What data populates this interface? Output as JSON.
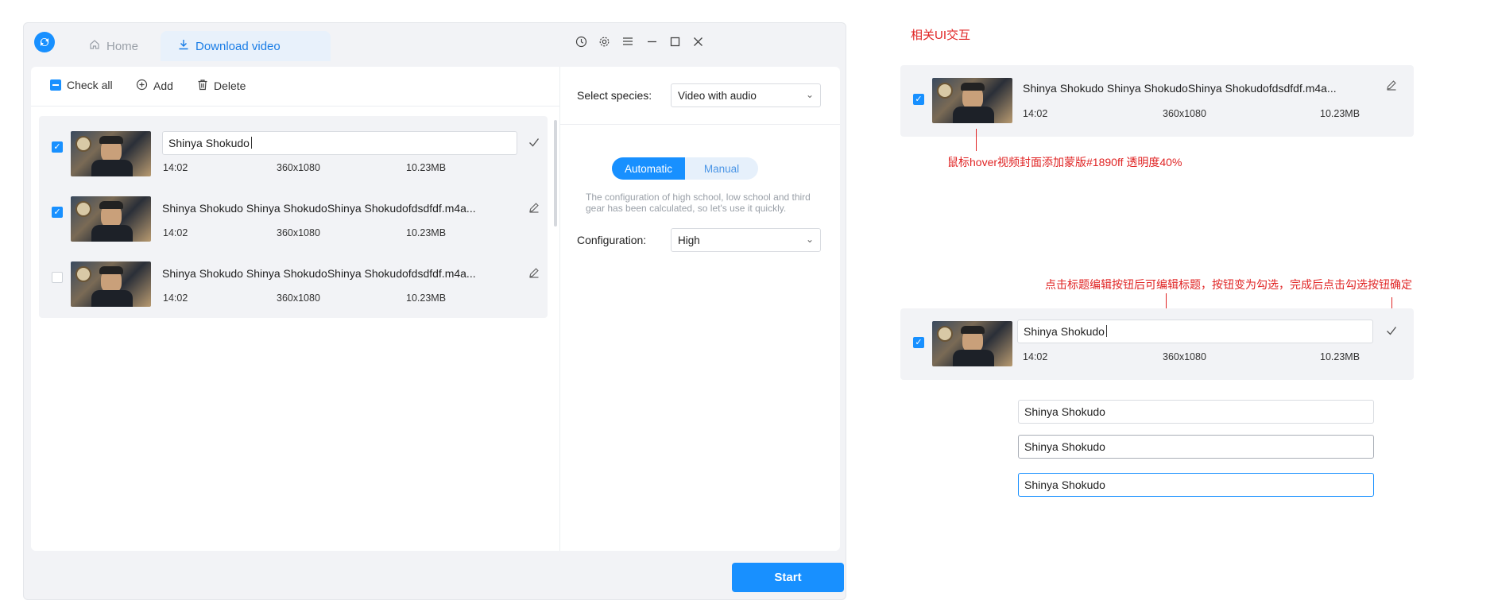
{
  "tabs": {
    "home": "Home",
    "download": "Download video"
  },
  "toolbar": {
    "check_all": "Check all",
    "add": "Add",
    "delete": "Delete"
  },
  "items": [
    {
      "edit_value": "Shinya Shokudo",
      "duration": "14:02",
      "resolution": "360x1080",
      "size": "10.23MB",
      "checked": true,
      "editing": true
    },
    {
      "title": "Shinya Shokudo Shinya ShokudoShinya Shokudofdsdfdf.m4a...",
      "duration": "14:02",
      "resolution": "360x1080",
      "size": "10.23MB",
      "checked": true,
      "editing": false
    },
    {
      "title": "Shinya Shokudo Shinya ShokudoShinya Shokudofdsdfdf.m4a...",
      "duration": "14:02",
      "resolution": "360x1080",
      "size": "10.23MB",
      "checked": false,
      "editing": false
    }
  ],
  "settings": {
    "species_label": "Select species:",
    "species_value": "Video with audio",
    "mode_automatic": "Automatic",
    "mode_manual": "Manual",
    "description": "The configuration of high school, low school and third gear has been calculated, so let's use it quickly.",
    "config_label": "Configuration:",
    "config_value": "High"
  },
  "start_label": "Start",
  "annotations": {
    "title": "相关UI交互",
    "hover_note": "鼠标hover视频封面添加蒙版#1890ff  透明度40%",
    "edit_note": "点击标题编辑按钮后可编辑标题，按钮变为勾选，完成后点击勾选按钮确定"
  },
  "demo_card_1": {
    "title": "Shinya Shokudo Shinya ShokudoShinya Shokudofdsdfdf.m4a...",
    "duration": "14:02",
    "resolution": "360x1080",
    "size": "10.23MB"
  },
  "demo_card_2": {
    "edit_value": "Shinya Shokudo",
    "duration": "14:02",
    "resolution": "360x1080",
    "size": "10.23MB"
  },
  "input_states": {
    "default": "Shinya Shokudo",
    "hover": "Shinya Shokudo",
    "focus": "Shinya Shokudo"
  },
  "colors": {
    "accent": "#1890ff",
    "annotation": "#e02424"
  }
}
